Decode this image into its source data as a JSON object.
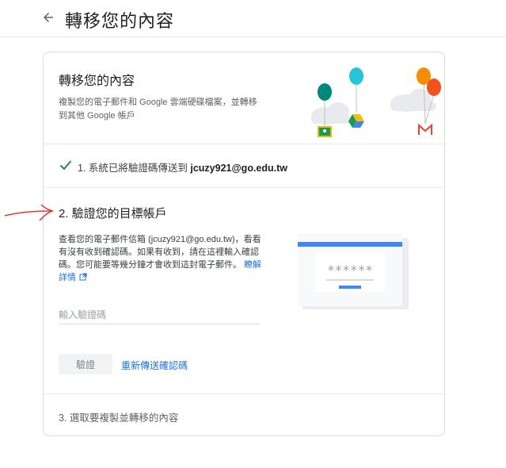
{
  "header": {
    "title": "轉移您的內容"
  },
  "card": {
    "title": "轉移您的內容",
    "description": "複製您的電子郵件和 Google 雲端硬碟檔案，並轉移到其他 Google 帳戶"
  },
  "step1": {
    "prefix": "1. 系統已將驗證碼傳送到 ",
    "email": "jcuzy921@go.edu.tw"
  },
  "step2": {
    "title": "2. 驗證您的目標帳戶",
    "description": "查看您的電子郵件信箱 (jcuzy921@go.edu.tw)，看看有沒有收到確認碼。如果有收到，請在這裡輸入確認碼。您可能要等幾分鐘才會收到這封電子郵件。",
    "learn_more": "瞭解詳情",
    "code_mask": "******",
    "input_placeholder": "輸入驗證碼",
    "verify_label": "驗證",
    "resend_label": "重新傳送確認碼"
  },
  "step3": {
    "text": "3. 選取要複製並轉移的內容"
  },
  "colors": {
    "accent": "#1a73e8",
    "check": "#1e8e3e",
    "annotation_arrow": "#e53935",
    "balloon_teal": "#00897b",
    "balloon_cyan": "#26c6da",
    "balloon_orange": "#fb8c00",
    "balloon_red": "#f4511e"
  }
}
